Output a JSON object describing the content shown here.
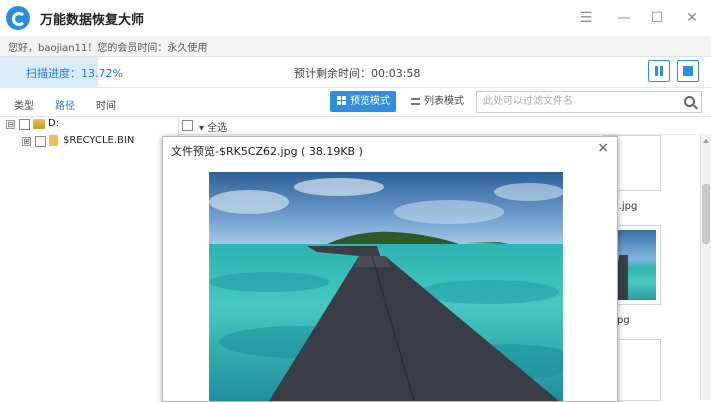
{
  "window": {
    "title": "万能数据恢复大师",
    "controls": [
      "menu-icon",
      "minimize-icon",
      "maximize-icon",
      "close-icon"
    ]
  },
  "account": {
    "greeting": "您好，baojian11！您的会员时间：永久使用"
  },
  "scan": {
    "progress_label": "扫描进度：13.72%",
    "progress_fraction": 0.1372,
    "remaining_label": "预计剩余时间：00:03:58",
    "pause_icon": "pause-icon",
    "stop_icon": "stop-icon"
  },
  "tabs": [
    {
      "label": "类型",
      "active": false
    },
    {
      "label": "路径",
      "active": true
    },
    {
      "label": "时间",
      "active": false
    }
  ],
  "view_modes": {
    "preview_label": "预览模式",
    "list_label": "列表模式",
    "active": "preview"
  },
  "search": {
    "placeholder": "此处可以过滤文件名"
  },
  "tree": {
    "drive": {
      "expander": "⊟",
      "label": "D:"
    },
    "folder": {
      "expander": "⊞",
      "label": "$RECYCLE.BIN"
    }
  },
  "content": {
    "select_all_label": "▾ 全选",
    "thumbnails": [
      {
        "name": "D.jpg"
      },
      {
        "name": ".jpg"
      }
    ]
  },
  "preview": {
    "title": "文件预览-$RK5CZ62.jpg ( 38.19KB )",
    "close_glyph": "×"
  },
  "colors": {
    "accent": "#2f8ee0",
    "progress_text": "#1f7ad0",
    "progress_fill": "#d9ecfb",
    "sky": "#3b6ea4",
    "sea": "#3cc4bd"
  }
}
